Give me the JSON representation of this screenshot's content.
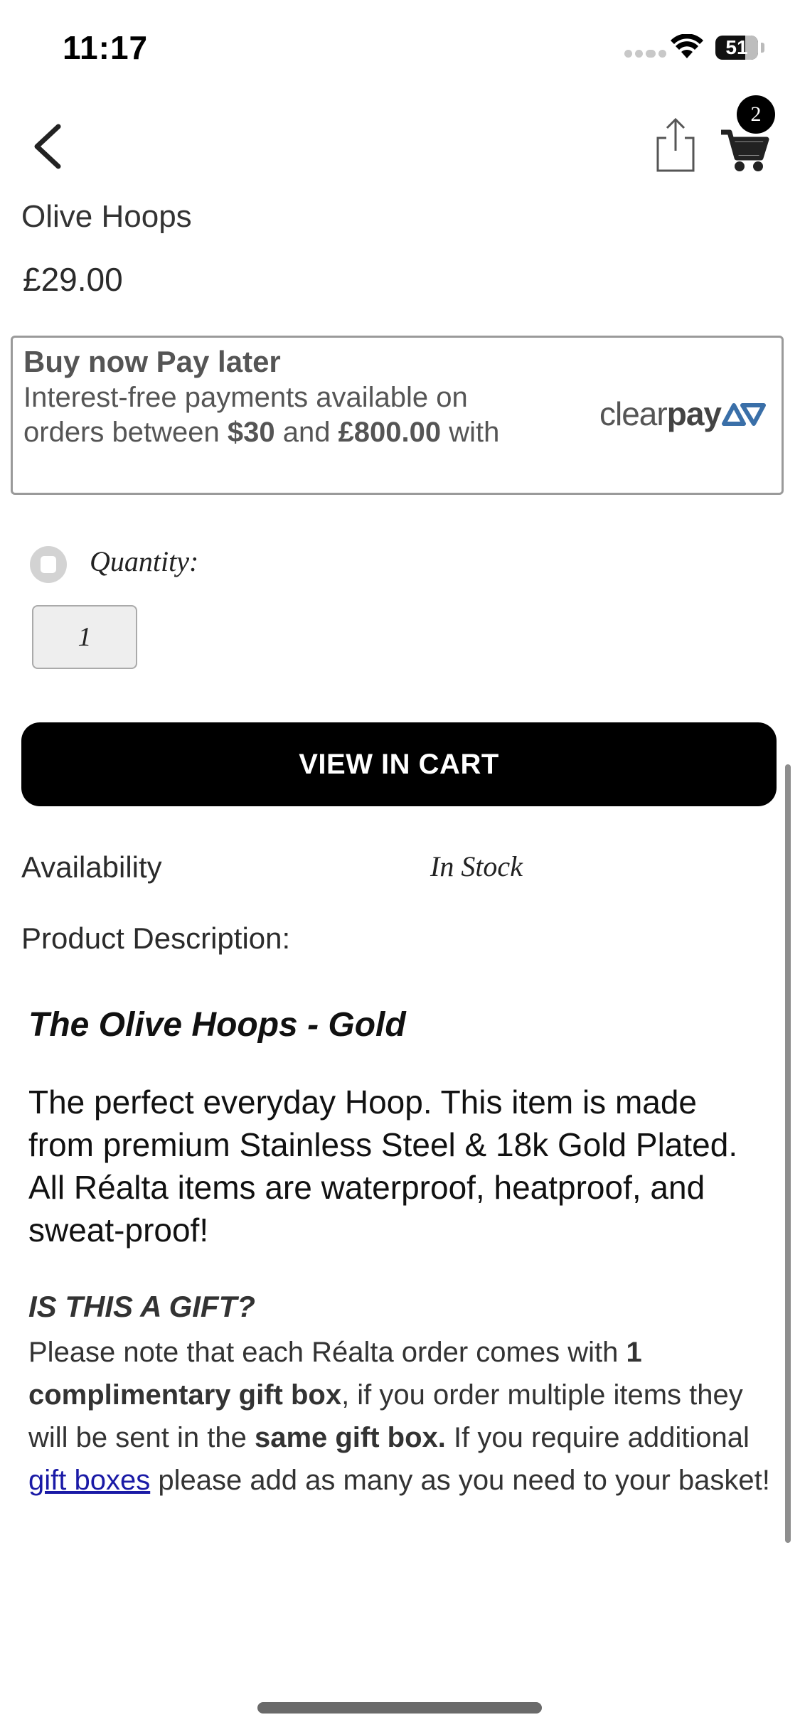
{
  "status_bar": {
    "time": "11:17",
    "battery": "51"
  },
  "nav": {
    "cart_count": "2"
  },
  "product": {
    "title": "Olive Hoops",
    "price": "£29.00"
  },
  "bnpl": {
    "heading": "Buy now Pay later",
    "text_part1": "Interest-free payments available on orders between ",
    "min_amount": "$30",
    "text_and": " and ",
    "max_amount": "£800.00",
    "text_part2": " with",
    "logo_light": "clear",
    "logo_bold": "pay"
  },
  "quantity": {
    "label": "Quantity:",
    "value": "1"
  },
  "view_cart_label": "VIEW IN CART",
  "availability": {
    "label": "Availability",
    "value": "In Stock"
  },
  "description": {
    "label": "Product Description:",
    "title": "The Olive Hoops - Gold",
    "body": "The perfect everyday Hoop. This item is made from premium Stainless Steel & 18k Gold Plated. All Réalta items are waterproof, heatproof, and sweat-proof!"
  },
  "gift": {
    "heading": "IS THIS A GIFT?",
    "t1": "Please note that each Réalta order comes with ",
    "b1": "1 complimentary gift box",
    "t2": ", if you order multiple items they will be sent in the ",
    "b2": "same gift box.",
    "t3": " If you require additional ",
    "link": "gift boxes",
    "t4": " please add as many as you need to your basket!"
  },
  "colors": {
    "button_bg": "#000000",
    "link": "#1a1aa6",
    "clearpay_accent": "#3a6fa8"
  }
}
